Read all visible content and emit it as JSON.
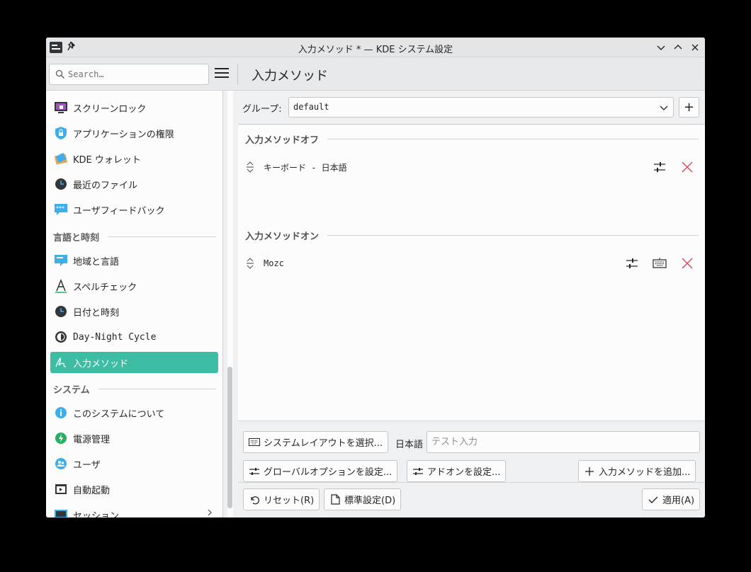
{
  "window": {
    "title": "入力メソッド * — KDE システム設定",
    "pin_glyph": "📌"
  },
  "topbar": {
    "search_placeholder": "Search…",
    "page_title": "入力メソッド"
  },
  "sidebar": {
    "items": [
      {
        "label": "スクリーンロック",
        "icon": "screen-lock-icon"
      },
      {
        "label": "アプリケーションの権限",
        "icon": "shield-icon"
      },
      {
        "label": "KDE ウォレット",
        "icon": "wallet-icon"
      },
      {
        "label": "最近のファイル",
        "icon": "clock-icon"
      },
      {
        "label": "ユーザフィードバック",
        "icon": "feedback-icon"
      },
      {
        "label": "地域と言語",
        "icon": "region-icon"
      },
      {
        "label": "スペルチェック",
        "icon": "spellcheck-icon"
      },
      {
        "label": "日付と時刻",
        "icon": "clock-icon"
      },
      {
        "label": "Day-Night Cycle",
        "icon": "day-night-icon"
      },
      {
        "label": "入力メソッド",
        "icon": "input-method-icon",
        "active": true
      },
      {
        "label": "このシステムについて",
        "icon": "info-icon"
      },
      {
        "label": "電源管理",
        "icon": "power-icon"
      },
      {
        "label": "ユーザ",
        "icon": "users-icon"
      },
      {
        "label": "自動起動",
        "icon": "autostart-icon"
      },
      {
        "label": "セッション",
        "icon": "session-icon"
      }
    ],
    "headers": {
      "language_time": "言語と時刻",
      "system": "システム"
    }
  },
  "group": {
    "label": "グループ:",
    "value": "default",
    "add_glyph": "+"
  },
  "input_methods": {
    "off_header": "入力メソッドオフ",
    "off_items": [
      {
        "label": "キーボード - 日本語"
      }
    ],
    "on_header": "入力メソッドオン",
    "on_items": [
      {
        "label": "Mozc"
      }
    ]
  },
  "bottom": {
    "select_layout": "システムレイアウトを選択...",
    "language": "日本語",
    "test_placeholder": "テスト入力",
    "global_options": "グローバルオプションを設定...",
    "addons": "アドオンを設定...",
    "add_im": "入力メソッドを追加...",
    "reset": "リセット(R)",
    "defaults": "標準設定(D)",
    "apply": "適用(A)"
  },
  "colors": {
    "accent": "#3dbea4",
    "delete": "#da4453"
  }
}
